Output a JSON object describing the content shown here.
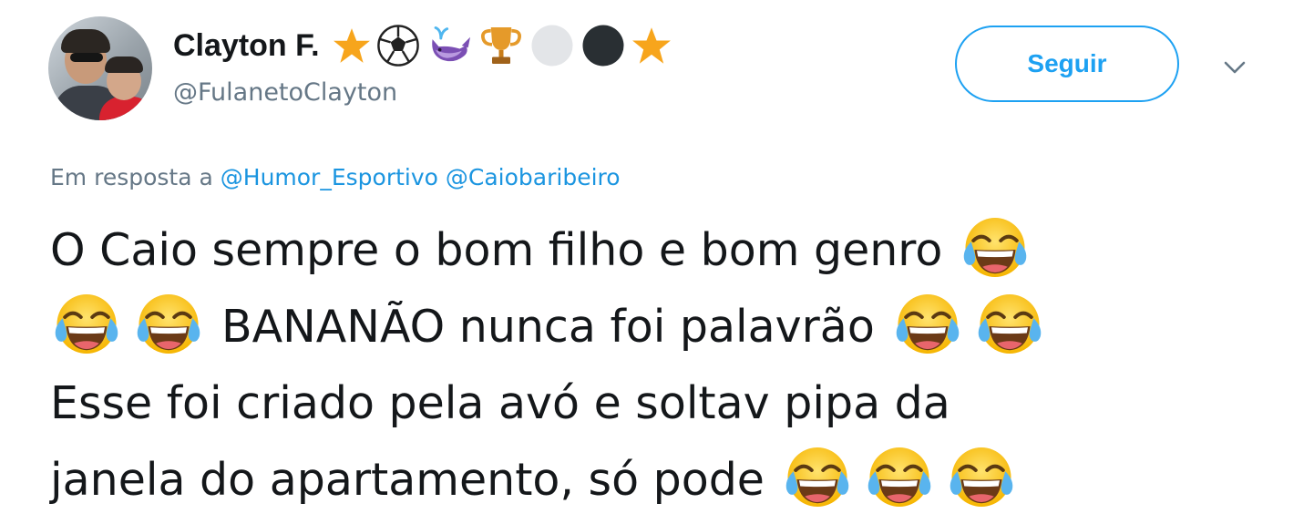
{
  "author": {
    "display_name": "Clayton F.",
    "handle": "@FulanetoClayton",
    "name_emoji": [
      "star-icon",
      "soccer-ball-icon",
      "whale-icon",
      "trophy-icon",
      "white-circle-icon",
      "black-circle-icon",
      "star-icon"
    ]
  },
  "actions": {
    "follow_label": "Seguir"
  },
  "reply_context": {
    "prefix": "Em resposta a",
    "mentions": [
      "@Humor_Esportivo",
      "@Caiobaribeiro"
    ]
  },
  "tweet": {
    "line1": "O Caio sempre o bom filho e bom genro",
    "line2": "BANANÃO nunca foi palavrão",
    "line3": "Esse foi criado pela avó e soltav pipa da",
    "line4": "janela do apartamento, só pode",
    "emoji_name": "face-with-tears-of-joy-icon"
  },
  "colors": {
    "accent": "#1da1f2",
    "mention": "#1b95e0",
    "secondary_text": "#657786",
    "primary_text": "#14171a"
  }
}
